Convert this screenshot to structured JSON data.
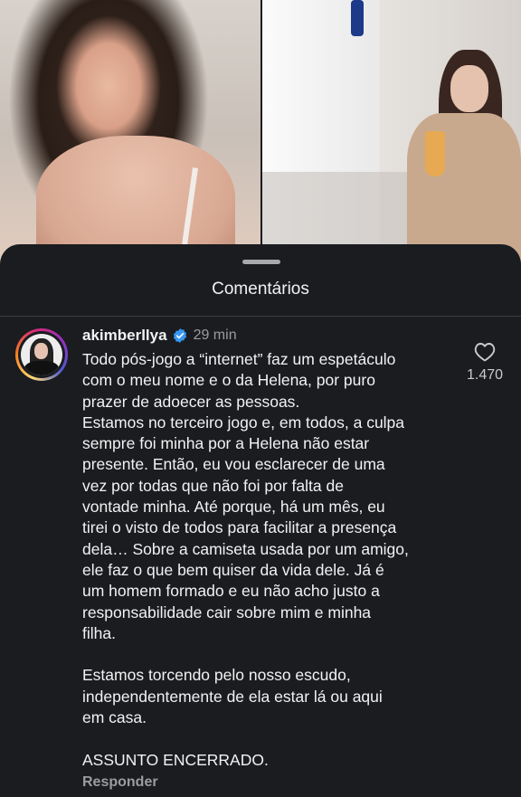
{
  "sheet": {
    "title": "Comentários"
  },
  "comment": {
    "username": "akimberllya",
    "verified_icon": "verified-badge-icon",
    "time": "29 min",
    "text": "Todo pós-jogo a “internet” faz um espetáculo\ncom o meu nome e o da Helena, por puro\nprazer de adoecer as pessoas.\nEstamos no terceiro jogo e, em todos, a culpa\nsempre foi minha por a Helena não estar\npresente. Então, eu vou esclarecer de uma\nvez por todas que não foi por falta de\nvontade minha. Até porque, há um mês, eu\ntirei o visto de todos para facilitar a presença\ndela… Sobre a camiseta usada por um amigo,\nele faz o que bem quiser da vida dele. Já é\num homem formado e eu não acho justo a\nresponsabilidade cair sobre mim e minha\nfilha.\n\nEstamos torcendo pelo nosso escudo,\nindependentemente de ela estar lá ou aqui\nem casa.\n\nASSUNTO ENCERRADO.",
    "reply_label": "Responder",
    "like_icon": "heart-outline-icon",
    "like_count": "1.470"
  },
  "colors": {
    "background": "#1a1c20",
    "text": "#f2f2f2",
    "muted": "#9a9ca0",
    "verified": "#3897f0"
  }
}
